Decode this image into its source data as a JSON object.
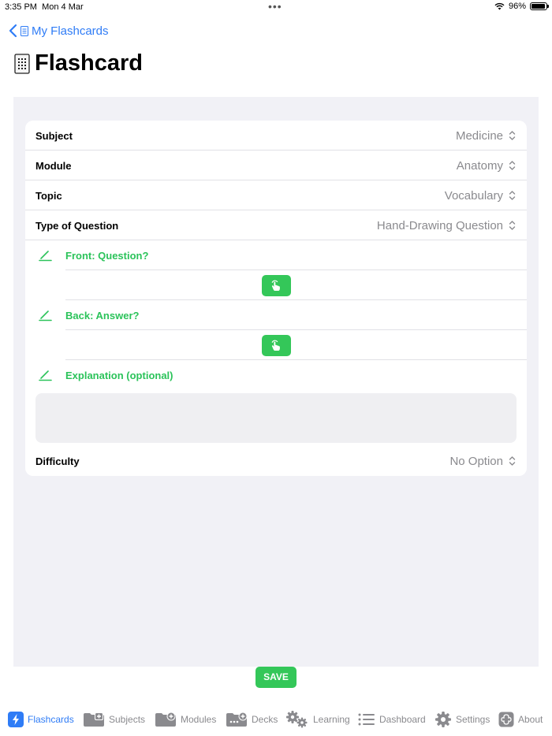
{
  "status_bar": {
    "time": "3:35 PM",
    "date": "Mon 4 Mar",
    "battery": "96%",
    "battery_level": 0.96,
    "dots": "•••"
  },
  "nav": {
    "back_label": "My Flashcards",
    "back_icon": "chevron-left-icon"
  },
  "page": {
    "title": "Flashcard",
    "title_icon": "flashcard-grid-icon"
  },
  "form": {
    "subject": {
      "label": "Subject",
      "value": "Medicine"
    },
    "module": {
      "label": "Module",
      "value": "Anatomy"
    },
    "topic": {
      "label": "Topic",
      "value": "Vocabulary"
    },
    "question_type": {
      "label": "Type of Question",
      "value": "Hand-Drawing Question"
    },
    "front": {
      "label": "Front: Question?"
    },
    "back": {
      "label": "Back: Answer?"
    },
    "explanation": {
      "label": "Explanation (optional)",
      "value": ""
    },
    "difficulty": {
      "label": "Difficulty",
      "value": "No Option"
    }
  },
  "actions": {
    "save_label": "SAVE"
  },
  "colors": {
    "accent_blue": "#2f7cf6",
    "accent_green": "#34c759",
    "panel_bg": "#f1f1f6",
    "secondary_text": "#8a8a8e"
  },
  "tabs": [
    {
      "label": "Flashcards",
      "icon": "lightning-icon",
      "active": true
    },
    {
      "label": "Subjects",
      "icon": "folder-plus-icon",
      "active": false
    },
    {
      "label": "Modules",
      "icon": "folder-plus-icon",
      "active": false
    },
    {
      "label": "Decks",
      "icon": "folder-dots-icon",
      "active": false
    },
    {
      "label": "Learning",
      "icon": "gears-icon",
      "active": false
    },
    {
      "label": "Dashboard",
      "icon": "list-icon",
      "active": false
    },
    {
      "label": "Settings",
      "icon": "gear-icon",
      "active": false
    },
    {
      "label": "About",
      "icon": "about-icon",
      "active": false
    }
  ]
}
